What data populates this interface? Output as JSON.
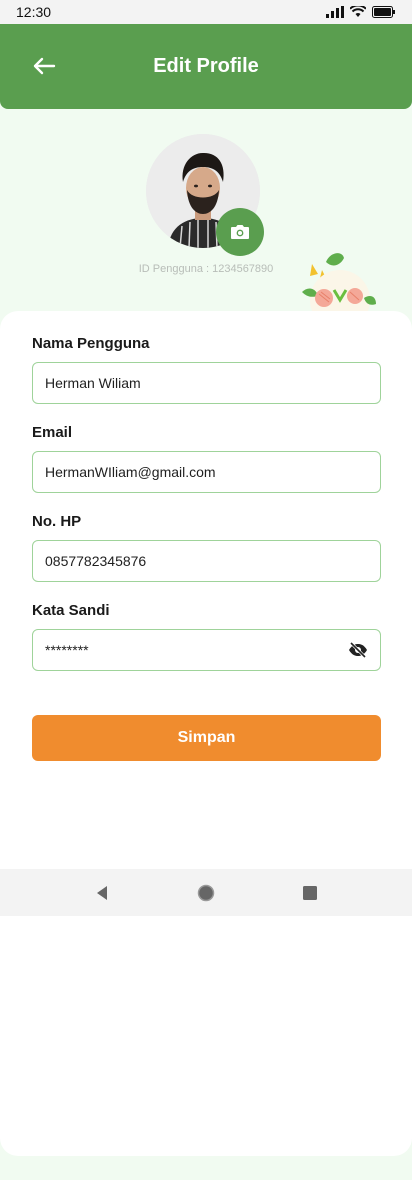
{
  "status_bar": {
    "time": "12:30"
  },
  "header": {
    "title": "Edit Profile",
    "back_icon": "arrow-left-icon"
  },
  "profile": {
    "user_id_text": "ID Pengguna : 1234567890",
    "camera_icon": "camera-icon"
  },
  "form": {
    "username": {
      "label": "Nama Pengguna",
      "value": "Herman Wiliam"
    },
    "email": {
      "label": "Email",
      "value": "HermanWIliam@gmail.com"
    },
    "phone": {
      "label": "No. HP",
      "value": "0857782345876"
    },
    "password": {
      "label": "Kata Sandi",
      "value": "********",
      "toggle_icon": "eye-off-icon"
    }
  },
  "save_button": {
    "label": "Simpan"
  },
  "colors": {
    "primary": "#5a9e4f",
    "accent": "#f08c2e",
    "border": "#9fd39a",
    "background": "#f1fbf1"
  }
}
